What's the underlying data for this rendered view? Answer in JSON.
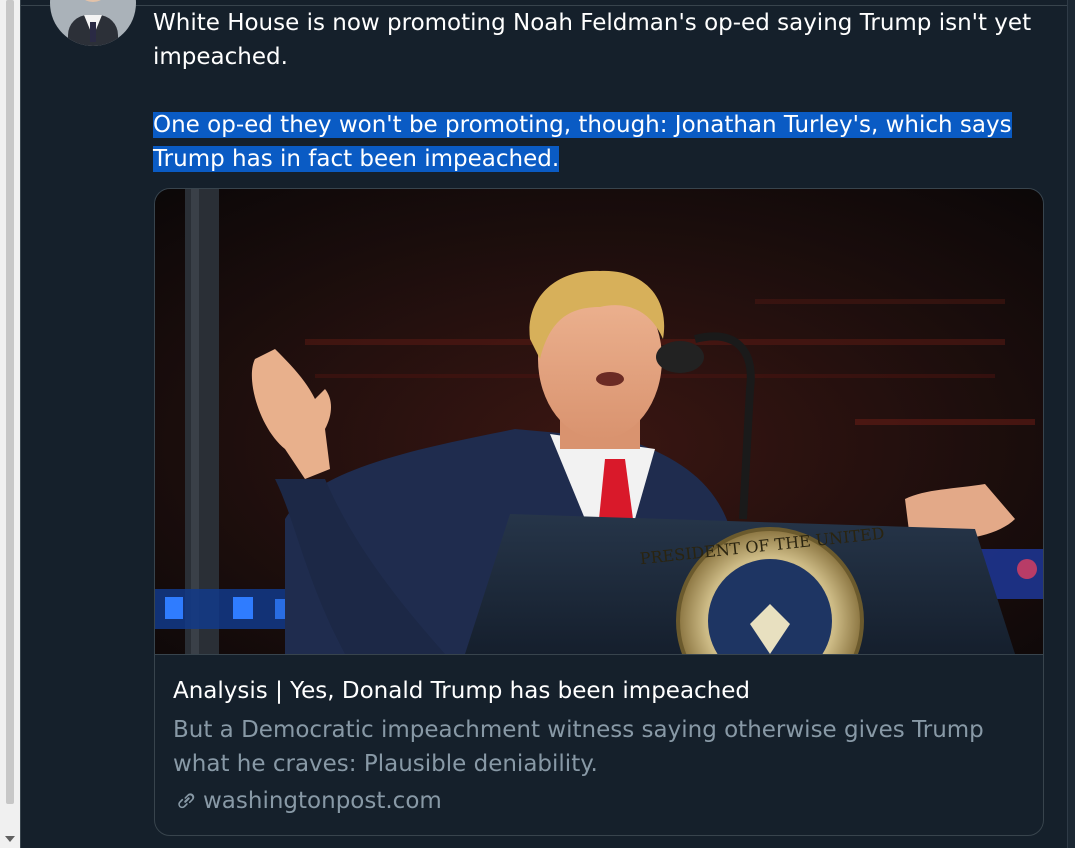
{
  "tweet": {
    "text_line_1": "White House is now promoting Noah Feldman's op-ed saying Trump isn't yet impeached.",
    "text_selected": "One op-ed they won't be promoting, though: Jonathan Turley's, which says Trump has in fact been impeached."
  },
  "card": {
    "title": "Analysis | Yes, Donald Trump has been impeached",
    "description": "But a Democratic impeachment witness saying otherwise gives Trump what he craves: Plausible deniability.",
    "domain": "washingtonpost.com",
    "image_icon": "photo-trump-at-presidential-podium",
    "seal_text": "PRESIDENT OF THE UNITED"
  },
  "icons": {
    "link": "link-icon",
    "scroll_down": "scroll-down-arrow-icon"
  },
  "colors": {
    "background": "#15202b",
    "text": "#ffffff",
    "secondary_text": "#8899a6",
    "selection": "#0a5bc4",
    "border": "#38444d"
  }
}
